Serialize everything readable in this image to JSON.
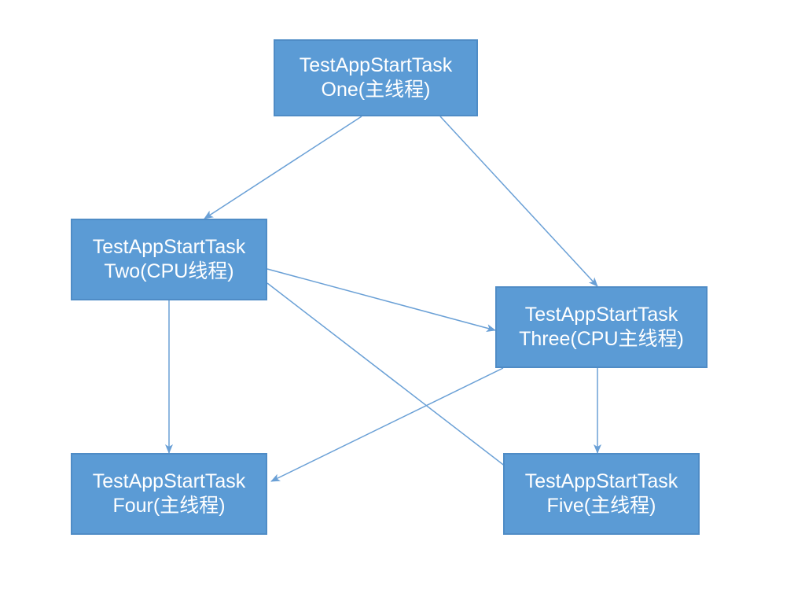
{
  "diagram": {
    "nodes": {
      "one": {
        "line1": "TestAppStartTask",
        "line2": "One(主线程)"
      },
      "two": {
        "line1": "TestAppStartTask",
        "line2": "Two(CPU线程)"
      },
      "three": {
        "line1": "TestAppStartTask",
        "line2": "Three(CPU主线程)"
      },
      "four": {
        "line1": "TestAppStartTask",
        "line2": "Four(主线程)"
      },
      "five": {
        "line1": "TestAppStartTask",
        "line2": "Five(主线程)"
      }
    },
    "colors": {
      "node_fill": "#5b9bd5",
      "node_border": "#4f8cc6",
      "arrow": "#6aa0d6"
    },
    "edges": [
      {
        "from": "one",
        "to": "two"
      },
      {
        "from": "one",
        "to": "three"
      },
      {
        "from": "two",
        "to": "three"
      },
      {
        "from": "two",
        "to": "four"
      },
      {
        "from": "two",
        "to": "five"
      },
      {
        "from": "three",
        "to": "four"
      },
      {
        "from": "three",
        "to": "five"
      }
    ]
  }
}
